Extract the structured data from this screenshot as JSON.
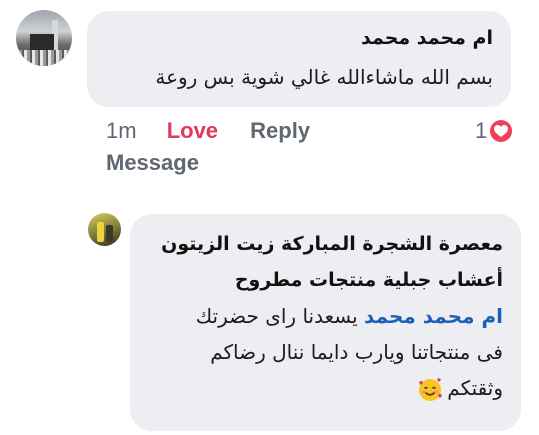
{
  "comment": {
    "author": "ام محمد محمد",
    "text": "بسم الله ماشاءالله غالي شوية بس روعة",
    "time": "1m",
    "love_label": "Love",
    "reply_label": "Reply",
    "message_label": "Message",
    "reaction_count": "1",
    "reaction_icon": "heart-icon",
    "love_color": "#e2385b"
  },
  "reply": {
    "author_line1": "معصرة الشجرة المباركة زيت الزيتون",
    "author_line2": "أعشاب جبلية منتجات مطروح",
    "mention": "ام محمد محمد",
    "text_line1": "يسعدنا راى حضرتك",
    "text_line2": "فى منتجاتنا ويارب دايما ننال رضاكم",
    "text_line3": "وثقتكم",
    "emoji": "smiling-face-with-hearts-icon",
    "mention_color": "#1d5fb8"
  },
  "colors": {
    "bubble": "#eceef1",
    "meta_text": "#606770",
    "heart": "#f33e58"
  }
}
